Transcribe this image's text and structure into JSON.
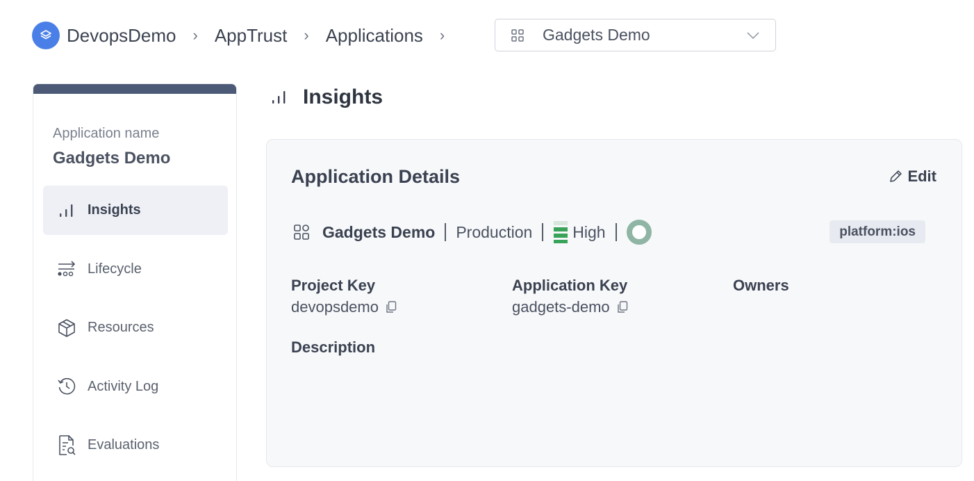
{
  "breadcrumb": {
    "org": "DevopsDemo",
    "section": "AppTrust",
    "page": "Applications",
    "sep": "›"
  },
  "app_selector": {
    "value": "Gadgets Demo"
  },
  "sidebar": {
    "app_name_label": "Application name",
    "app_name": "Gadgets Demo",
    "items": [
      {
        "label": "Insights",
        "icon": "bar-chart-icon",
        "active": true
      },
      {
        "label": "Lifecycle",
        "icon": "lifecycle-icon",
        "active": false
      },
      {
        "label": "Resources",
        "icon": "package-icon",
        "active": false
      },
      {
        "label": "Activity Log",
        "icon": "history-icon",
        "active": false
      },
      {
        "label": "Evaluations",
        "icon": "document-search-icon",
        "active": false
      }
    ]
  },
  "page_title": "Insights",
  "details": {
    "title": "Application Details",
    "edit_label": "Edit",
    "app_name": "Gadgets Demo",
    "environment": "Production",
    "criticality": "High",
    "tag": "platform:ios",
    "project_key_label": "Project Key",
    "project_key": "devopsdemo",
    "application_key_label": "Application Key",
    "application_key": "gadgets-demo",
    "owners_label": "Owners",
    "description_label": "Description"
  },
  "colors": {
    "brand": "#4a7fe8",
    "criticality_high": "#3aa35a",
    "owner_ring": "#8fb5a4",
    "sidebar_accent": "#4c5a78"
  }
}
